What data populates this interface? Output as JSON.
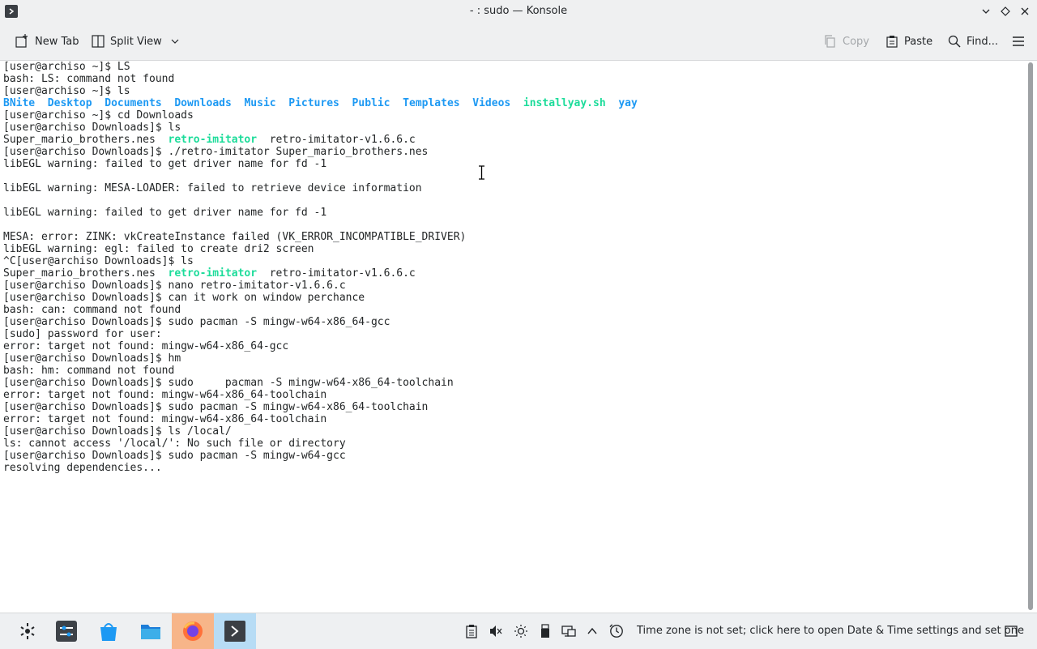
{
  "window": {
    "title": "- : sudo — Konsole"
  },
  "toolbar": {
    "new_tab": "New Tab",
    "split_view": "Split View",
    "copy": "Copy",
    "paste": "Paste",
    "find": "Find..."
  },
  "terminal": {
    "lines": [
      [
        {
          "t": "[user@archiso ~]$ LS"
        }
      ],
      [
        {
          "t": "bash: LS: command not found"
        }
      ],
      [
        {
          "t": "[user@archiso ~]$ ls"
        }
      ],
      [
        {
          "t": "BNite",
          "c": "blue"
        },
        {
          "t": "  "
        },
        {
          "t": "Desktop",
          "c": "blue"
        },
        {
          "t": "  "
        },
        {
          "t": "Documents",
          "c": "blue"
        },
        {
          "t": "  "
        },
        {
          "t": "Downloads",
          "c": "blue"
        },
        {
          "t": "  "
        },
        {
          "t": "Music",
          "c": "blue"
        },
        {
          "t": "  "
        },
        {
          "t": "Pictures",
          "c": "blue"
        },
        {
          "t": "  "
        },
        {
          "t": "Public",
          "c": "blue"
        },
        {
          "t": "  "
        },
        {
          "t": "Templates",
          "c": "blue"
        },
        {
          "t": "  "
        },
        {
          "t": "Videos",
          "c": "blue"
        },
        {
          "t": "  "
        },
        {
          "t": "installyay.sh",
          "c": "green"
        },
        {
          "t": "  "
        },
        {
          "t": "yay",
          "c": "blue"
        }
      ],
      [
        {
          "t": "[user@archiso ~]$ cd Downloads"
        }
      ],
      [
        {
          "t": "[user@archiso Downloads]$ ls"
        }
      ],
      [
        {
          "t": "Super_mario_brothers.nes  "
        },
        {
          "t": "retro-imitator",
          "c": "green"
        },
        {
          "t": "  retro-imitator-v1.6.6.c"
        }
      ],
      [
        {
          "t": "[user@archiso Downloads]$ ./retro-imitator Super_mario_brothers.nes"
        }
      ],
      [
        {
          "t": "libEGL warning: failed to get driver name for fd -1"
        }
      ],
      [
        {
          "t": ""
        }
      ],
      [
        {
          "t": "libEGL warning: MESA-LOADER: failed to retrieve device information"
        }
      ],
      [
        {
          "t": ""
        }
      ],
      [
        {
          "t": "libEGL warning: failed to get driver name for fd -1"
        }
      ],
      [
        {
          "t": ""
        }
      ],
      [
        {
          "t": "MESA: error: ZINK: vkCreateInstance failed (VK_ERROR_INCOMPATIBLE_DRIVER)"
        }
      ],
      [
        {
          "t": "libEGL warning: egl: failed to create dri2 screen"
        }
      ],
      [
        {
          "t": "^C[user@archiso Downloads]$ ls"
        }
      ],
      [
        {
          "t": "Super_mario_brothers.nes  "
        },
        {
          "t": "retro-imitator",
          "c": "green"
        },
        {
          "t": "  retro-imitator-v1.6.6.c"
        }
      ],
      [
        {
          "t": "[user@archiso Downloads]$ nano retro-imitator-v1.6.6.c"
        }
      ],
      [
        {
          "t": "[user@archiso Downloads]$ can it work on window perchance"
        }
      ],
      [
        {
          "t": "bash: can: command not found"
        }
      ],
      [
        {
          "t": "[user@archiso Downloads]$ sudo pacman -S mingw-w64-x86_64-gcc"
        }
      ],
      [
        {
          "t": "[sudo] password for user:"
        }
      ],
      [
        {
          "t": "error: target not found: mingw-w64-x86_64-gcc"
        }
      ],
      [
        {
          "t": "[user@archiso Downloads]$ hm"
        }
      ],
      [
        {
          "t": "bash: hm: command not found"
        }
      ],
      [
        {
          "t": "[user@archiso Downloads]$ sudo     pacman -S mingw-w64-x86_64-toolchain"
        }
      ],
      [
        {
          "t": "error: target not found: mingw-w64-x86_64-toolchain"
        }
      ],
      [
        {
          "t": "[user@archiso Downloads]$ sudo pacman -S mingw-w64-x86_64-toolchain"
        }
      ],
      [
        {
          "t": "error: target not found: mingw-w64-x86_64-toolchain"
        }
      ],
      [
        {
          "t": "[user@archiso Downloads]$ ls /local/"
        }
      ],
      [
        {
          "t": "ls: cannot access '/local/': No such file or directory"
        }
      ],
      [
        {
          "t": "[user@archiso Downloads]$ sudo pacman -S mingw-w64-gcc"
        }
      ],
      [
        {
          "t": "resolving dependencies..."
        }
      ]
    ]
  },
  "taskbar": {
    "status_text": "Time zone is not set; click here to open Date & Time settings and set one"
  },
  "icons": {
    "app": "konsole-icon",
    "new_tab": "new-tab-icon",
    "split_view": "split-view-icon",
    "copy": "copy-icon",
    "paste": "paste-icon",
    "find": "search-icon",
    "menu": "hamburger-menu-icon"
  },
  "colors": {
    "accent_blue": "#1d99f3",
    "accent_green": "#1cdc9a"
  }
}
